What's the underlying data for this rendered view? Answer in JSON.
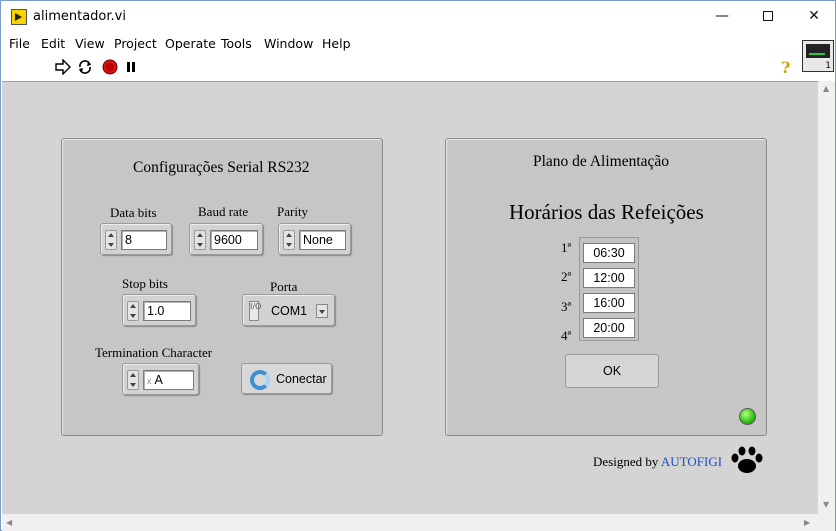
{
  "window": {
    "title": "alimentador.vi",
    "min_label": "—",
    "close_label": "✕"
  },
  "menu": [
    "File",
    "Edit",
    "View",
    "Project",
    "Operate",
    "Tools",
    "Window",
    "Help"
  ],
  "toolbar": {
    "icons": [
      "run-icon",
      "run-continuously-icon",
      "abort-icon",
      "pause-icon"
    ],
    "help_label": "?",
    "vi_icon_number": "1"
  },
  "serial_panel": {
    "title": "Configurações Serial RS232",
    "data_bits": {
      "label": "Data bits",
      "value": "8"
    },
    "baud_rate": {
      "label": "Baud rate",
      "value": "9600"
    },
    "parity": {
      "label": "Parity",
      "value": "None"
    },
    "stop_bits": {
      "label": "Stop bits",
      "value": "1.0"
    },
    "porta": {
      "label": "Porta",
      "value": "COM1",
      "io_glyph": "I/O"
    },
    "termination": {
      "label": "Termination Character",
      "value": "A",
      "prefix": "x"
    },
    "connect_button": "Conectar"
  },
  "feeding_panel": {
    "title": "Plano de Alimentação",
    "heading": "Horários das Refeições",
    "meals": [
      {
        "ordinal": "1ª",
        "time": "06:30"
      },
      {
        "ordinal": "2ª",
        "time": "12:00"
      },
      {
        "ordinal": "3ª",
        "time": "16:00"
      },
      {
        "ordinal": "4ª",
        "time": "20:00"
      }
    ],
    "ok_button": "OK",
    "led_color": "#34c818"
  },
  "footer": {
    "designed_by": "Designed by",
    "brand": "AUTOFIGI",
    "brand_color": "#1f4fbf"
  }
}
